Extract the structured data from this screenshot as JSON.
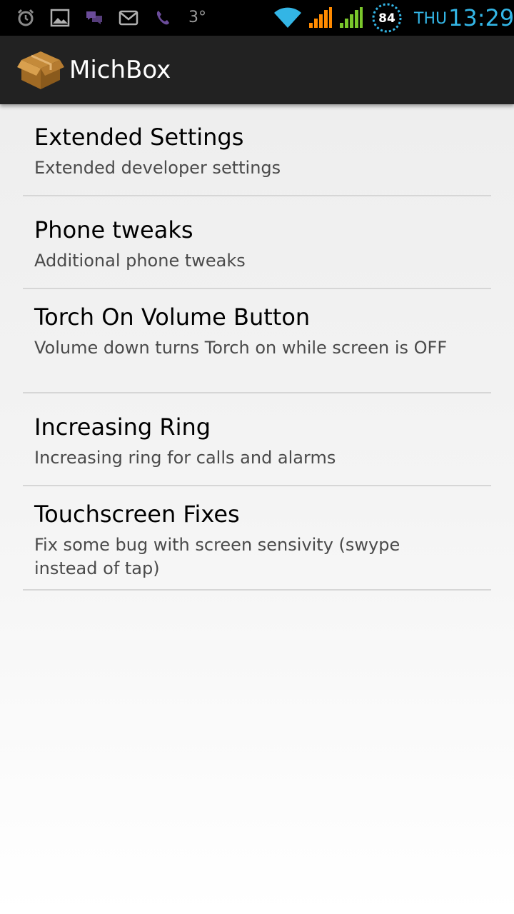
{
  "status_bar": {
    "icons": [
      "alarm-icon",
      "image-icon",
      "chat-icon",
      "mail-icon",
      "viber-icon",
      "wifi-icon",
      "signal-icon",
      "signal-icon",
      "battery-icon"
    ],
    "temperature": "3°",
    "battery_level": "84",
    "day": "THU",
    "time": "13:29",
    "accent_color": "#33b5e5"
  },
  "action_bar": {
    "title": "MichBox",
    "icon": "box-icon"
  },
  "preferences": [
    {
      "title": "Extended Settings",
      "summary": "Extended developer settings"
    },
    {
      "title": "Phone tweaks",
      "summary": "Additional phone tweaks"
    },
    {
      "title": "Torch On Volume Button",
      "summary": "Volume down turns Torch on while screen is OFF"
    },
    {
      "title": "Increasing Ring",
      "summary": "Increasing ring for calls and alarms"
    },
    {
      "title": "Touchscreen Fixes",
      "summary": "Fix some bug with screen sensivity (swype instead of tap)"
    }
  ]
}
